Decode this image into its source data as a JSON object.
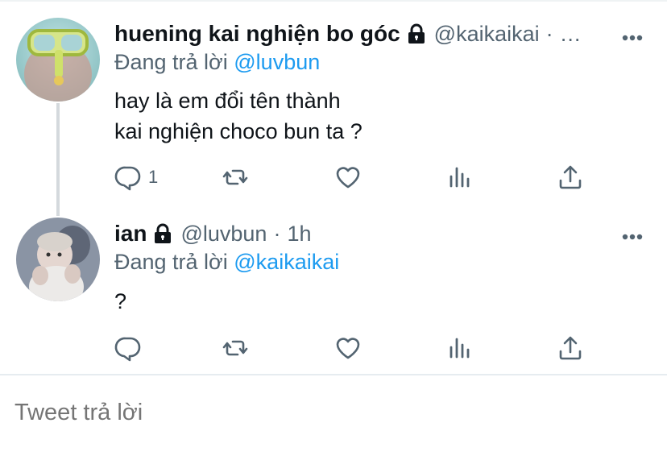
{
  "tweets": [
    {
      "display_name": "huening kai nghiện bo góc",
      "handle": "@kaikaikai",
      "sep": "·",
      "time": "…",
      "reply_prefix": "Đang trả lời ",
      "reply_to": "@luvbun",
      "body": "hay là em đổi tên thành\nkai nghiện choco bun ta ?",
      "reply_count": "1",
      "avatar_icon": "avatar-snorkel-photo"
    },
    {
      "display_name": "ian",
      "handle": "@luvbun",
      "sep": "·",
      "time": "1h",
      "reply_prefix": "Đang trả lời ",
      "reply_to": "@kaikaikai",
      "body": "?",
      "reply_count": "",
      "avatar_icon": "avatar-baby-photo"
    }
  ],
  "reply_box": {
    "placeholder": "Tweet trả lời"
  },
  "colors": {
    "accent": "#1d9bf0",
    "muted": "#536471",
    "text": "#0f1419"
  }
}
